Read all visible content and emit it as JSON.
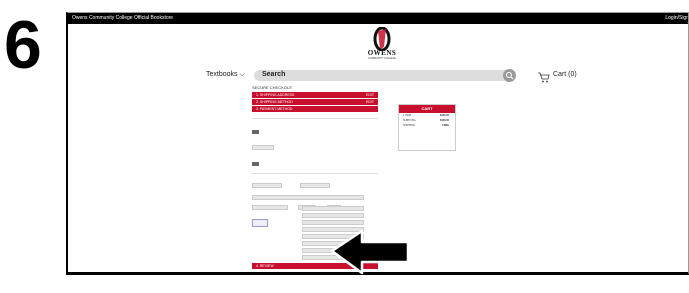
{
  "step_number": "6",
  "topbar": {
    "site_title": "Owens Community College Official Bookstore",
    "login": "Login/Sign"
  },
  "logo": {
    "name": "OWENS",
    "subtitle": "COMMUNITY COLLEGE"
  },
  "nav": {
    "textbooks": "Textbooks",
    "search_placeholder": "Search",
    "cart": "Cart (0)"
  },
  "checkout": {
    "heading": "SECURE CHECKOUT",
    "steps": [
      {
        "label": "1. SHIPPING ADDRESS",
        "edit": "EDIT"
      },
      {
        "label": "2. SHIPPING METHOD",
        "edit": "EDIT"
      },
      {
        "label": "3. PAYMENT METHOD",
        "edit": ""
      }
    ],
    "review": "4. REVIEW"
  },
  "cart_summary": {
    "title": "CART",
    "rows": [
      {
        "label": "1 ITEM",
        "value": "$160.95"
      },
      {
        "label": "SUBTOTAL",
        "value": "$160.95"
      },
      {
        "label": "SHIPPING",
        "value": "FREE"
      }
    ]
  },
  "colors": {
    "accent": "#c8102e",
    "topbar": "#000000"
  }
}
